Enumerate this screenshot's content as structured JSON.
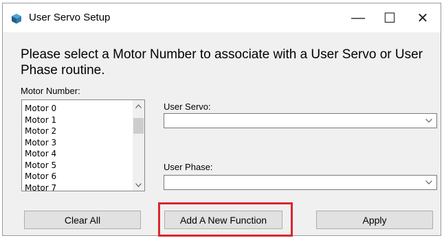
{
  "window": {
    "title": "User Servo Setup",
    "controls": {
      "minimize": "—",
      "maximize": "☐",
      "close": "✕"
    }
  },
  "instructions": "Please select a Motor Number to associate with a User Servo or User Phase routine.",
  "motor_number": {
    "label": "Motor Number:",
    "items": [
      "Motor 0",
      "Motor 1",
      "Motor 2",
      "Motor 3",
      "Motor 4",
      "Motor 5",
      "Motor 6",
      "Motor 7"
    ],
    "scroll_up": "^",
    "scroll_down": "v"
  },
  "user_servo": {
    "label": "User Servo:",
    "value": "",
    "arrow": "v"
  },
  "user_phase": {
    "label": "User Phase:",
    "value": "",
    "arrow": "v"
  },
  "buttons": {
    "clear_all": "Clear All",
    "add_new_function": "Add A New Function",
    "apply": "Apply"
  },
  "colors": {
    "highlight": "#d9262e",
    "icon": "#1f5f86"
  }
}
